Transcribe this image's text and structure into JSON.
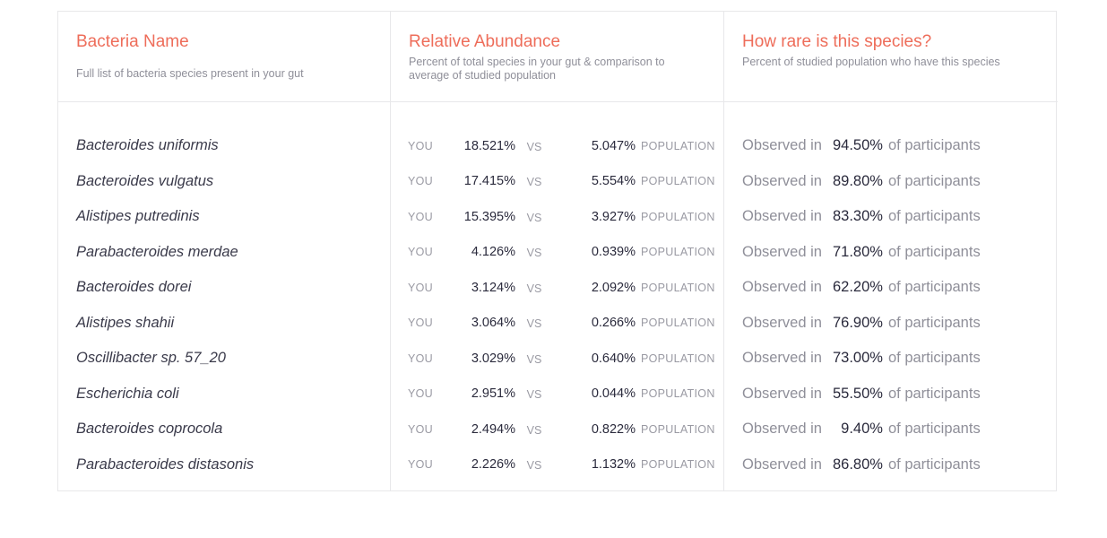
{
  "columns": {
    "name": {
      "title": "Bacteria Name",
      "subtitle": "Full list of bacteria species present in your gut"
    },
    "abundance": {
      "title": "Relative Abundance",
      "subtitle": "Percent of total species in your gut & comparison to average of studied population"
    },
    "rarity": {
      "title": "How rare is this species?",
      "subtitle": "Percent of studied population who have this species"
    }
  },
  "labels": {
    "you": "YOU",
    "vs": "VS",
    "population": "POPULATION",
    "observed_in": "Observed in",
    "of_participants": "of participants"
  },
  "rows": [
    {
      "species": "Bacteroides uniformis",
      "you": "18.521%",
      "population": "5.047%",
      "observed": "94.50%"
    },
    {
      "species": "Bacteroides vulgatus",
      "you": "17.415%",
      "population": "5.554%",
      "observed": "89.80%"
    },
    {
      "species": "Alistipes putredinis",
      "you": "15.395%",
      "population": "3.927%",
      "observed": "83.30%"
    },
    {
      "species": "Parabacteroides merdae",
      "you": "4.126%",
      "population": "0.939%",
      "observed": "71.80%"
    },
    {
      "species": "Bacteroides dorei",
      "you": "3.124%",
      "population": "2.092%",
      "observed": "62.20%"
    },
    {
      "species": "Alistipes shahii",
      "you": "3.064%",
      "population": "0.266%",
      "observed": "76.90%"
    },
    {
      "species": "Oscillibacter sp. 57_20",
      "you": "3.029%",
      "population": "0.640%",
      "observed": "73.00%"
    },
    {
      "species": "Escherichia coli",
      "you": "2.951%",
      "population": "0.044%",
      "observed": "55.50%"
    },
    {
      "species": "Bacteroides coprocola",
      "you": "2.494%",
      "population": "0.822%",
      "observed": "9.40%"
    },
    {
      "species": "Parabacteroides distasonis",
      "you": "2.226%",
      "population": "1.132%",
      "observed": "86.80%"
    }
  ],
  "colors": {
    "accent": "#ee6d5a",
    "text_dark": "#2a2a3c",
    "text_muted": "#8f8f99",
    "border": "#e8e8ea"
  }
}
